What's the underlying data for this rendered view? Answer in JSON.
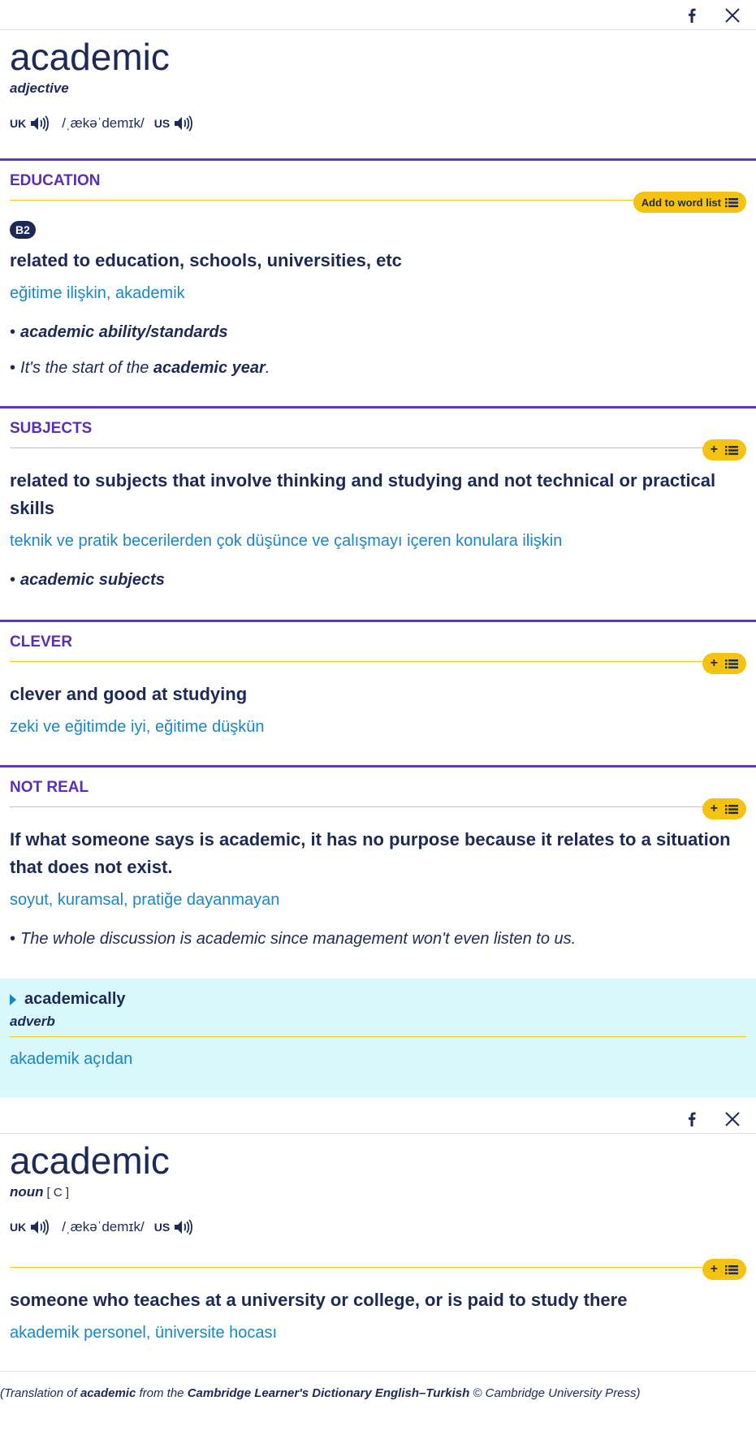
{
  "share_icons": [
    "facebook-icon",
    "x-icon"
  ],
  "entry1": {
    "headword": "academic",
    "pos": "adjective",
    "uk_label": "UK",
    "us_label": "US",
    "ipa": "/ˌækəˈdemɪk/",
    "add_to_word_list": "Add to word list"
  },
  "senses": [
    {
      "title": "EDUCATION",
      "level": "B2",
      "definition": "related to education, schools, universities, etc",
      "translation": "eğitime ilişkin, akademik",
      "examples": [
        {
          "pre": "",
          "bold": "academic ability/standards",
          "post": ""
        },
        {
          "pre": "It's the start of the ",
          "bold": "academic year",
          "post": "."
        }
      ]
    },
    {
      "title": "SUBJECTS",
      "definition": "related to subjects that involve thinking and studying and not technical or practical skills",
      "translation": "teknik ve pratik becerilerden çok düşünce ve çalışmayı içeren konulara ilişkin",
      "examples": [
        {
          "pre": "",
          "bold": "academic subjects",
          "post": ""
        }
      ]
    },
    {
      "title": "CLEVER",
      "definition": "clever and good at studying",
      "translation": "zeki ve eğitimde iyi, eğitime düşkün"
    },
    {
      "title": "NOT REAL",
      "definition": "If what someone says is academic, it has no purpose because it relates to a situation that does not exist.",
      "translation": "soyut, kuramsal, pratiğe dayanmayan",
      "examples": [
        {
          "pre": "The whole discussion is academic since management won't even listen to us.",
          "bold": "",
          "post": ""
        }
      ]
    }
  ],
  "runon": {
    "word": "academically",
    "pos": "adverb",
    "translation": "akademik açıdan"
  },
  "entry2": {
    "headword": "academic",
    "pos": "noun",
    "grammar": "[ C ]",
    "uk_label": "UK",
    "us_label": "US",
    "ipa": "/ˌækəˈdemɪk/",
    "definition": "someone who teaches at a university or college, or is paid to study there",
    "translation": "akademik personel, üniversite hocası"
  },
  "footer": {
    "p1": "(Translation of ",
    "b1": "academic",
    "p2": " from the ",
    "b2": "Cambridge Learner's Dictionary English–Turkish",
    "p3": " © Cambridge University Press)"
  }
}
